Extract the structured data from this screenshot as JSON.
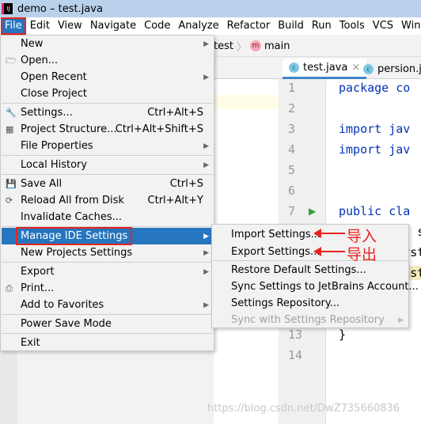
{
  "window": {
    "title": "demo – test.java"
  },
  "menubar": [
    "File",
    "Edit",
    "View",
    "Navigate",
    "Code",
    "Analyze",
    "Refactor",
    "Build",
    "Run",
    "Tools",
    "VCS",
    "Window"
  ],
  "breadcrumb": {
    "prev": "test",
    "method_icon": "m",
    "method": "main"
  },
  "tabs": [
    {
      "label": "test.java",
      "icon": "c"
    },
    {
      "label": "persion.java",
      "icon": "c"
    }
  ],
  "file_menu": [
    {
      "label": "New",
      "submenu": true
    },
    {
      "label": "Open...",
      "icon": "folder-icon"
    },
    {
      "label": "Open Recent",
      "submenu": true
    },
    {
      "label": "Close Project"
    },
    {
      "label": "Settings...",
      "shortcut": "Ctrl+Alt+S",
      "icon": "wrench-icon"
    },
    {
      "label": "Project Structure...",
      "shortcut": "Ctrl+Alt+Shift+S",
      "icon": "project-structure-icon"
    },
    {
      "label": "File Properties",
      "submenu": true
    },
    {
      "label": "Local History",
      "submenu": true
    },
    {
      "label": "Save All",
      "shortcut": "Ctrl+S",
      "icon": "save-icon"
    },
    {
      "label": "Reload All from Disk",
      "shortcut": "Ctrl+Alt+Y",
      "icon": "reload-icon"
    },
    {
      "label": "Invalidate Caches..."
    },
    {
      "label": "Manage IDE Settings",
      "submenu": true,
      "highlighted": true
    },
    {
      "label": "New Projects Settings",
      "submenu": true
    },
    {
      "label": "Export",
      "submenu": true
    },
    {
      "label": "Print...",
      "icon": "print-icon"
    },
    {
      "label": "Add to Favorites",
      "submenu": true
    },
    {
      "label": "Power Save Mode"
    },
    {
      "label": "Exit"
    }
  ],
  "sub_menu": [
    {
      "label": "Import Settings..."
    },
    {
      "label": "Export Settings..."
    },
    {
      "label": "Restore Default Settings..."
    },
    {
      "label": "Sync Settings to JetBrains Account..."
    },
    {
      "label": "Settings Repository..."
    },
    {
      "label": "Sync with Settings Repository",
      "disabled": true,
      "submenu": true
    }
  ],
  "annotations": {
    "import": "导入",
    "export": "导出"
  },
  "code_lines": [
    "package co",
    "",
    "import jav",
    "import jav",
    "",
    "",
    "public cla",
    "    public static void main",
    "        System",
    "        List",
    "",
    "",
    "}",
    ""
  ],
  "line_numbers": [
    "1",
    "2",
    "3",
    "4",
    "5",
    "6",
    "7",
    "8",
    "9",
    "10",
    "11",
    "12",
    "13",
    "14"
  ],
  "watermark": "https://blog.csdn.net/DwZ735660836",
  "colors": {
    "selection": "#2675bf",
    "annotation": "#e8231f",
    "keyword": "#0033b3"
  }
}
